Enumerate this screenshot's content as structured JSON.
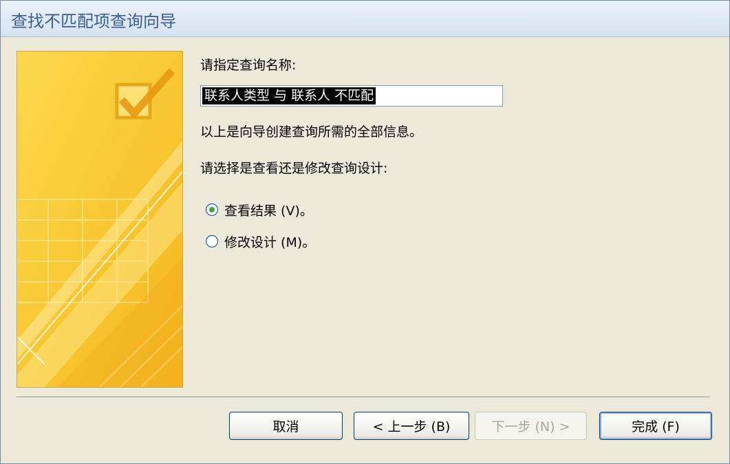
{
  "window": {
    "title": "查找不匹配项查询向导"
  },
  "form": {
    "query_name_prompt": "请指定查询名称:",
    "query_name_value": "联系人类型 与 联系人 不匹配",
    "info_text": "以上是向导创建查询所需的全部信息。",
    "choice_prompt": "请选择是查看还是修改查询设计:",
    "options": [
      {
        "label": "查看结果 (V)。",
        "selected": true
      },
      {
        "label": "修改设计 (M)。",
        "selected": false
      }
    ]
  },
  "buttons": {
    "cancel": "取消",
    "back": "< 上一步 (B)",
    "next": "下一步 (N) >",
    "finish": "完成 (F)"
  },
  "colors": {
    "art_yellow": "#f7c938",
    "art_light": "#fbe27a",
    "radio_green": "#3aa83a",
    "title_text": "#3b5f8c"
  }
}
